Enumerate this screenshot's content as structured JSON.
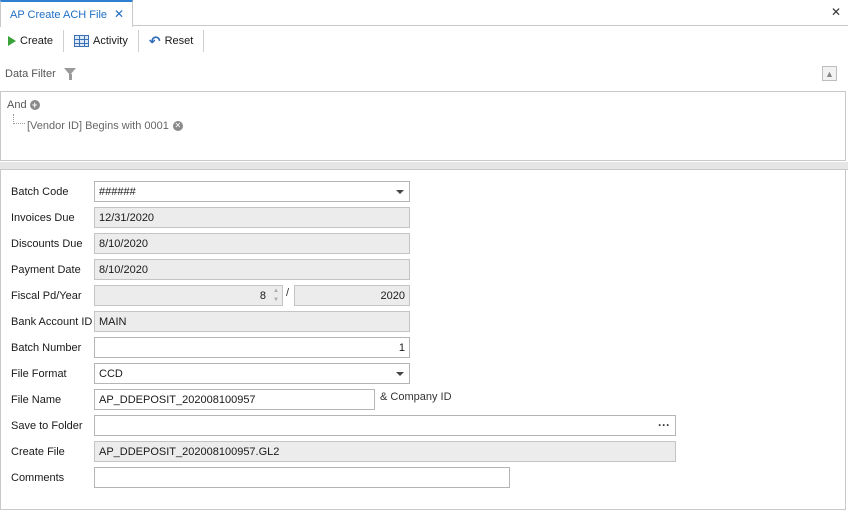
{
  "tab": {
    "title": "AP Create ACH File",
    "close": "✕"
  },
  "window": {
    "close": "✕"
  },
  "toolbar": {
    "create": "Create",
    "activity": "Activity",
    "reset": "Reset"
  },
  "filter": {
    "header": "Data Filter",
    "root_operator": "And",
    "conditions": [
      "[Vendor ID] Begins with 0001"
    ]
  },
  "form": {
    "batch_code": {
      "label": "Batch Code",
      "value": "######"
    },
    "invoices_due": {
      "label": "Invoices Due",
      "value": "12/31/2020"
    },
    "discounts_due": {
      "label": "Discounts Due",
      "value": "8/10/2020"
    },
    "payment_date": {
      "label": "Payment Date",
      "value": "8/10/2020"
    },
    "fiscal_pd_year": {
      "label": "Fiscal Pd/Year",
      "period": "8",
      "separator": "/",
      "year": "2020"
    },
    "bank_account_id": {
      "label": "Bank Account ID",
      "value": "MAIN"
    },
    "batch_number": {
      "label": "Batch Number",
      "value": "1"
    },
    "file_format": {
      "label": "File Format",
      "value": "CCD"
    },
    "file_name": {
      "label": "File Name",
      "value": "AP_DDEPOSIT_202008100957",
      "note": "& Company ID"
    },
    "save_to_folder": {
      "label": "Save to Folder",
      "value": "",
      "browse": "···"
    },
    "create_file": {
      "label": "Create File",
      "value": "AP_DDEPOSIT_202008100957.GL2"
    },
    "comments": {
      "label": "Comments",
      "value": ""
    }
  }
}
